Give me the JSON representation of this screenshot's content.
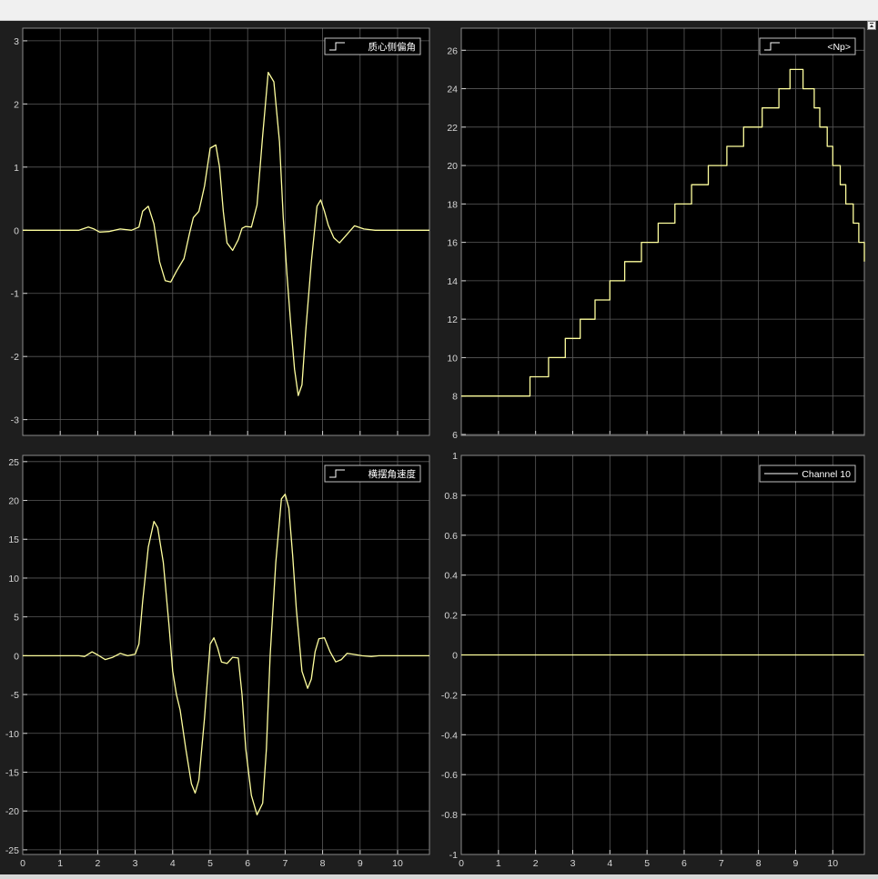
{
  "colors": {
    "background": "#1e1e1e",
    "axes_background": "#000000",
    "grid": "#5a5a5a",
    "axis_text": "#d6d6d6",
    "signal": "#ffff9e",
    "legend_border": "#bfbfbf"
  },
  "chart_data": [
    {
      "type": "line",
      "title": "",
      "xlabel": "",
      "ylabel": "",
      "xlim": [
        0,
        10.85
      ],
      "ylim": [
        -3.25,
        3.2
      ],
      "xticks": [
        0,
        1,
        2,
        3,
        4,
        5,
        6,
        7,
        8,
        9,
        10
      ],
      "xtick_labels": [],
      "yticks": [
        -3,
        -2,
        -1,
        0,
        1,
        2,
        3
      ],
      "ytick_labels": [
        "-3",
        "-2",
        "-1",
        "0",
        "1",
        "2",
        "3"
      ],
      "grid": true,
      "legend_position": "top-right",
      "step": false,
      "series": [
        {
          "name": "质心侧偏角",
          "color": "#ffff9e",
          "x": [
            0,
            1.5,
            1.75,
            1.9,
            2.05,
            2.3,
            2.6,
            2.9,
            3.1,
            3.2,
            3.35,
            3.5,
            3.65,
            3.8,
            3.95,
            4.1,
            4.3,
            4.45,
            4.55,
            4.7,
            4.85,
            5.0,
            5.15,
            5.25,
            5.35,
            5.45,
            5.6,
            5.75,
            5.85,
            5.95,
            6.1,
            6.25,
            6.4,
            6.55,
            6.7,
            6.85,
            6.95,
            7.05,
            7.15,
            7.25,
            7.35,
            7.45,
            7.55,
            7.7,
            7.85,
            7.95,
            8.05,
            8.15,
            8.3,
            8.45,
            8.6,
            8.85,
            9.1,
            9.4,
            10.0,
            10.85
          ],
          "values": [
            0,
            0,
            0.05,
            0.02,
            -0.03,
            -0.02,
            0.02,
            0,
            0.05,
            0.3,
            0.38,
            0.1,
            -0.5,
            -0.8,
            -0.82,
            -0.65,
            -0.45,
            -0.05,
            0.2,
            0.3,
            0.7,
            1.3,
            1.35,
            1.0,
            0.3,
            -0.2,
            -0.32,
            -0.15,
            0.03,
            0.06,
            0.05,
            0.4,
            1.5,
            2.5,
            2.35,
            1.4,
            0.2,
            -0.7,
            -1.5,
            -2.2,
            -2.62,
            -2.45,
            -1.6,
            -0.5,
            0.38,
            0.48,
            0.3,
            0.08,
            -0.12,
            -0.2,
            -0.1,
            0.07,
            0.02,
            0,
            0,
            0
          ]
        }
      ]
    },
    {
      "type": "line",
      "title": "",
      "xlabel": "",
      "ylabel": "",
      "xlim": [
        0,
        10.85
      ],
      "ylim": [
        5.95,
        27.15
      ],
      "xticks": [
        0,
        1,
        2,
        3,
        4,
        5,
        6,
        7,
        8,
        9,
        10
      ],
      "xtick_labels": [],
      "yticks": [
        6,
        8,
        10,
        12,
        14,
        16,
        18,
        20,
        22,
        24,
        26
      ],
      "ytick_labels": [
        "6",
        "8",
        "10",
        "12",
        "14",
        "16",
        "18",
        "20",
        "22",
        "24",
        "26"
      ],
      "grid": true,
      "legend_position": "top-right",
      "step": true,
      "series": [
        {
          "name": "<Np>",
          "color": "#ffff9e",
          "x": [
            0,
            1.85,
            2.35,
            2.8,
            3.2,
            3.6,
            4.0,
            4.4,
            4.85,
            5.3,
            5.75,
            6.2,
            6.65,
            7.15,
            7.6,
            8.1,
            8.55,
            8.85,
            9.2,
            9.5,
            9.65,
            9.85,
            10.0,
            10.2,
            10.35,
            10.55,
            10.7,
            10.85
          ],
          "values": [
            8,
            9,
            10,
            11,
            12,
            13,
            14,
            15,
            16,
            17,
            18,
            19,
            20,
            21,
            22,
            23,
            24,
            25,
            24,
            23,
            22,
            21,
            20,
            19,
            18,
            17,
            16,
            15
          ]
        }
      ]
    },
    {
      "type": "line",
      "title": "",
      "xlabel": "",
      "ylabel": "",
      "xlim": [
        0,
        10.85
      ],
      "ylim": [
        -25.6,
        25.8
      ],
      "xticks": [
        0,
        1,
        2,
        3,
        4,
        5,
        6,
        7,
        8,
        9,
        10
      ],
      "xtick_labels": [
        "0",
        "1",
        "2",
        "3",
        "4",
        "5",
        "6",
        "7",
        "8",
        "9",
        "10"
      ],
      "yticks": [
        -25,
        -20,
        -15,
        -10,
        -5,
        0,
        5,
        10,
        15,
        20,
        25
      ],
      "ytick_labels": [
        "-25",
        "-20",
        "-15",
        "-10",
        "-5",
        "0",
        "5",
        "10",
        "15",
        "20",
        "25"
      ],
      "grid": true,
      "legend_position": "top-right",
      "step": false,
      "series": [
        {
          "name": "横摆角速度",
          "color": "#ffff9e",
          "x": [
            0,
            1.5,
            1.65,
            1.85,
            2.0,
            2.2,
            2.4,
            2.6,
            2.8,
            3.0,
            3.1,
            3.2,
            3.35,
            3.5,
            3.6,
            3.75,
            3.9,
            4.0,
            4.1,
            4.2,
            4.35,
            4.5,
            4.6,
            4.7,
            4.85,
            5.0,
            5.1,
            5.2,
            5.3,
            5.45,
            5.6,
            5.75,
            5.85,
            5.95,
            6.1,
            6.25,
            6.4,
            6.5,
            6.6,
            6.75,
            6.9,
            7.0,
            7.1,
            7.2,
            7.3,
            7.45,
            7.6,
            7.7,
            7.8,
            7.9,
            8.05,
            8.2,
            8.35,
            8.5,
            8.65,
            8.8,
            9.05,
            9.3,
            9.5,
            10.0,
            10.85
          ],
          "values": [
            0,
            0,
            -0.1,
            0.5,
            0.1,
            -0.5,
            -0.2,
            0.3,
            0,
            0.2,
            1.5,
            7,
            14,
            17.3,
            16.5,
            12,
            4,
            -2,
            -5,
            -7,
            -12,
            -16.5,
            -17.7,
            -16,
            -8,
            1.5,
            2.3,
            1,
            -0.8,
            -1,
            -0.2,
            -0.3,
            -5,
            -12,
            -18,
            -20.5,
            -19,
            -12,
            0,
            12,
            20.2,
            20.8,
            19,
            13,
            6,
            -2,
            -4.2,
            -3,
            0.5,
            2.2,
            2.3,
            0.5,
            -0.8,
            -0.5,
            0.3,
            0.2,
            0,
            -0.1,
            0,
            0,
            0
          ]
        }
      ]
    },
    {
      "type": "line",
      "title": "",
      "xlabel": "",
      "ylabel": "",
      "xlim": [
        0,
        10.85
      ],
      "ylim": [
        -1,
        1
      ],
      "xticks": [
        0,
        1,
        2,
        3,
        4,
        5,
        6,
        7,
        8,
        9,
        10
      ],
      "xtick_labels": [
        "0",
        "1",
        "2",
        "3",
        "4",
        "5",
        "6",
        "7",
        "8",
        "9",
        "10"
      ],
      "yticks": [
        -1,
        -0.8,
        -0.6,
        -0.4,
        -0.2,
        0,
        0.2,
        0.4,
        0.6,
        0.8,
        1
      ],
      "ytick_labels": [
        "-1",
        "-0.8",
        "-0.6",
        "-0.4",
        "-0.2",
        "0",
        "0.2",
        "0.4",
        "0.6",
        "0.8",
        "1"
      ],
      "grid": true,
      "legend_position": "top-right",
      "step": false,
      "series": [
        {
          "name": "Channel 10",
          "color": "#ffff9e",
          "x": [
            0,
            10.85
          ],
          "values": [
            0,
            0
          ]
        }
      ]
    }
  ]
}
